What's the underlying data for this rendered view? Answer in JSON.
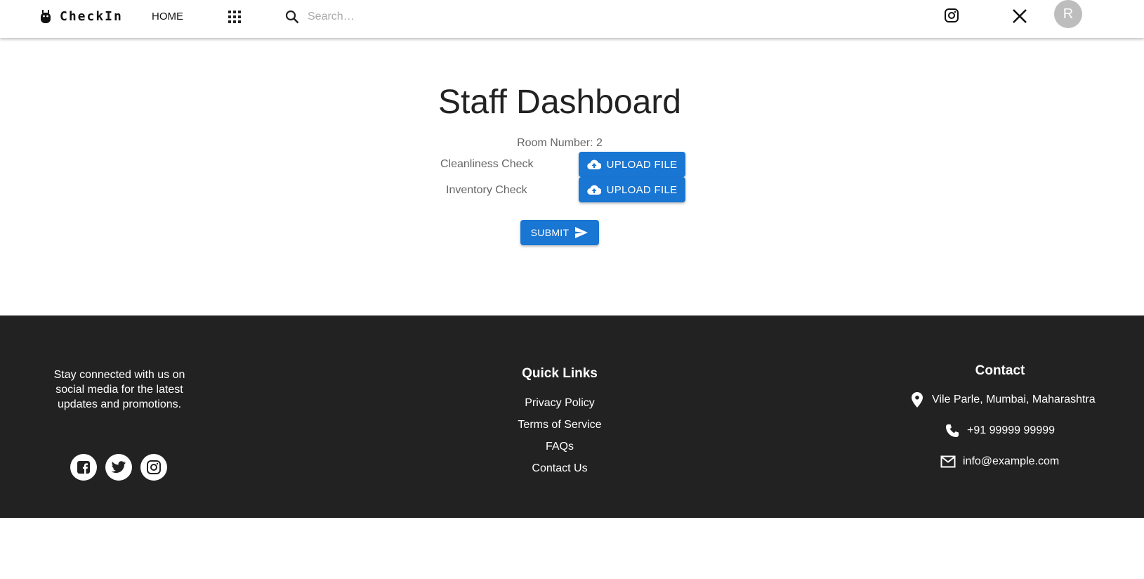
{
  "header": {
    "brand": "CheckIn",
    "nav_home": "HOME",
    "search_placeholder": "Search…",
    "avatar_initial": "R",
    "icons": [
      "robot-icon",
      "apps-grid-icon",
      "search-icon",
      "instagram-icon",
      "x-icon"
    ]
  },
  "main": {
    "title": "Staff Dashboard",
    "room": "Room Number: 2",
    "checks": [
      {
        "label": "Cleanliness Check",
        "button": "UPLOAD FILE"
      },
      {
        "label": "Inventory Check",
        "button": "UPLOAD FILE"
      }
    ],
    "submit": "SUBMIT"
  },
  "footer": {
    "tagline": "Stay connected with us on social media for the latest updates and promotions.",
    "social_icons": [
      "facebook-icon",
      "twitter-icon",
      "instagram-icon"
    ],
    "quick_links_title": "Quick Links",
    "quick_links": [
      "Privacy Policy",
      "Terms of Service",
      "FAQs",
      "Contact Us"
    ],
    "contact_title": "Contact",
    "address": "Vile Parle, Mumbai, Maharashtra",
    "phone": "+91 99999 99999",
    "email": "info@example.com"
  },
  "colors": {
    "primary": "#1976d2",
    "footer_bg": "#222222",
    "avatar_bg": "#bdbdbd"
  }
}
